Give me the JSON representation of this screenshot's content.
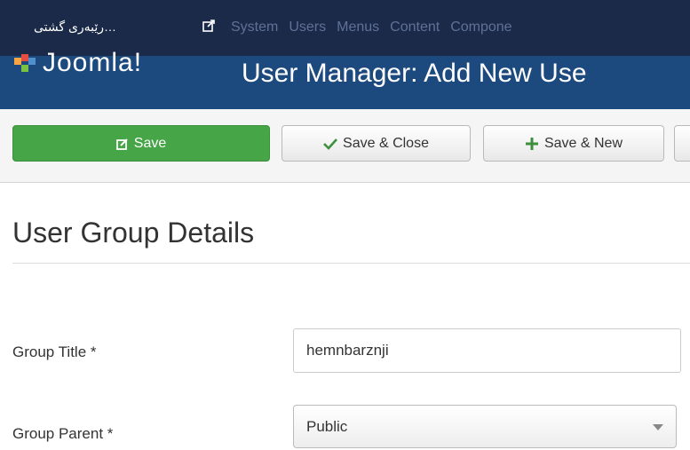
{
  "navbar": {
    "site_link": "…رێبەری گشتی",
    "menu": [
      "System",
      "Users",
      "Menus",
      "Content",
      "Compone"
    ]
  },
  "header": {
    "logo_text": "Joomla!",
    "title": "User Manager: Add New Use"
  },
  "toolbar": {
    "save_label": "Save",
    "save_close_label": "Save & Close",
    "save_new_label": "Save & New"
  },
  "form": {
    "section_title": "User Group Details",
    "group_title_label": "Group Title *",
    "group_title_value": "hemnbarznji",
    "group_parent_label": "Group Parent *",
    "group_parent_value": "Public"
  },
  "colors": {
    "navbar_bg": "#1a2a48",
    "header_bg": "#1d4a7e",
    "save_green": "#46a546"
  }
}
